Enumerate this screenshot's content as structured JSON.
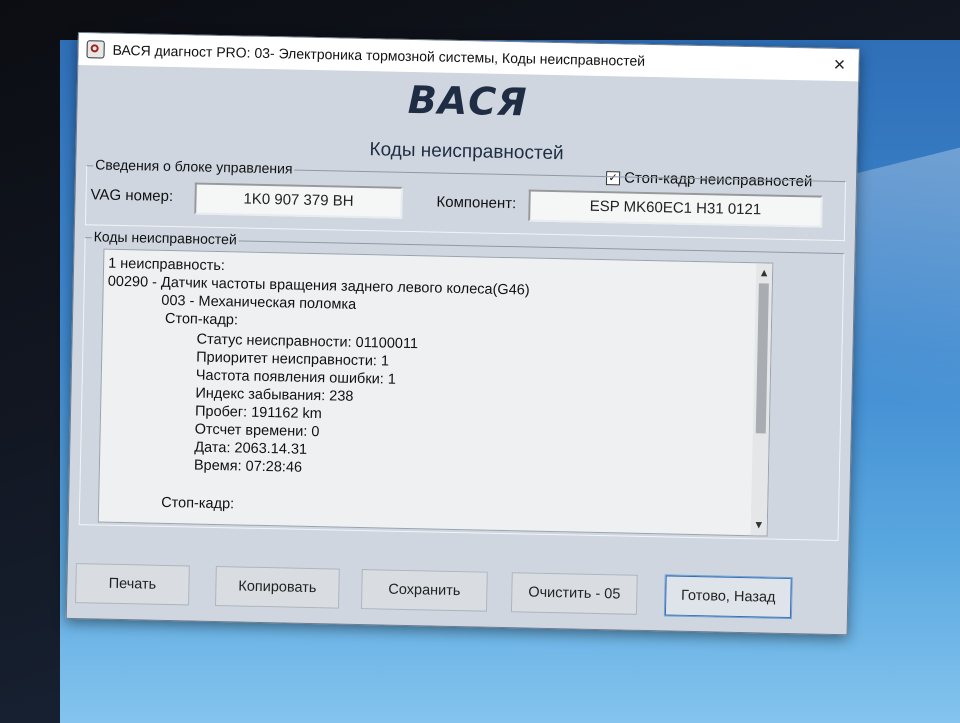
{
  "window": {
    "title": "ВАСЯ диагност PRO: 03- Электроника тормозной системы,  Коды неисправностей",
    "close_symbol": "×"
  },
  "header": {
    "logo": "ВАСЯ",
    "subtitle": "Коды неисправностей"
  },
  "freeze_frame_checkbox": {
    "label": "Стоп-кадр неисправностей",
    "checked": true,
    "mark": "✓"
  },
  "ecu_info": {
    "group_title": "Сведения о блоке управления",
    "vag_label": "VAG номер:",
    "vag_value": "1K0 907 379 BH",
    "component_label": "Компонент:",
    "component_value": "ESP MK60EC1   H31 0121"
  },
  "fault_codes": {
    "group_title": "Коды неисправностей",
    "lines": [
      "1 неисправность:",
      "00290 - Датчик частоты вращения заднего левого колеса(G46)",
      "003 - Механическая поломка",
      "Стоп-кадр:",
      "Статус неисправности: 01100011",
      "Приоритет неисправности: 1",
      "Частота появления ошибки: 1",
      "Индекс забывания: 238",
      "Пробег: 191162 km",
      "Отсчет времени: 0",
      "Дата: 2063.14.31",
      "Время: 07:28:46",
      "Стоп-кадр:"
    ],
    "scroll_up": "▲",
    "scroll_down": "▼"
  },
  "buttons": {
    "print": "Печать",
    "copy": "Копировать",
    "save": "Сохранить",
    "clear": "Очистить - 05",
    "done": "Готово, Назад"
  }
}
